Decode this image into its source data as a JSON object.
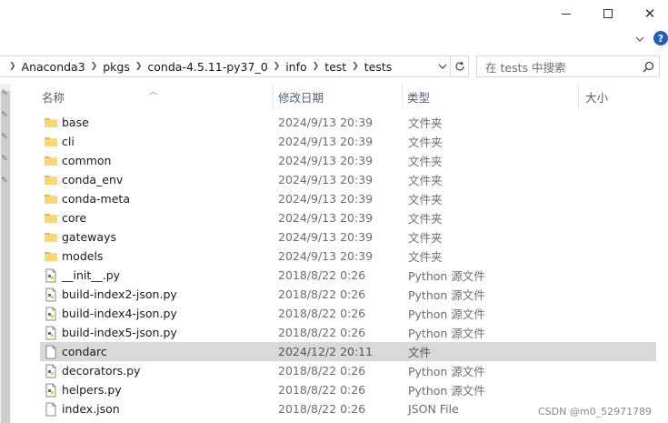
{
  "window": {
    "close_glyph": "✕"
  },
  "ribbon": {
    "help_label": "?"
  },
  "address_bar": {
    "crumbs": [
      "Anaconda3",
      "pkgs",
      "conda-4.5.11-py37_0",
      "info",
      "test",
      "tests"
    ]
  },
  "search": {
    "placeholder": "在 tests 中搜索"
  },
  "columns": {
    "name": "名称",
    "date": "修改日期",
    "type": "类型",
    "size": "大小"
  },
  "files": [
    {
      "name": "base",
      "date": "2024/9/13 20:39",
      "type": "文件夹",
      "icon": "folder-icon"
    },
    {
      "name": "cli",
      "date": "2024/9/13 20:39",
      "type": "文件夹",
      "icon": "folder-icon"
    },
    {
      "name": "common",
      "date": "2024/9/13 20:39",
      "type": "文件夹",
      "icon": "folder-icon"
    },
    {
      "name": "conda_env",
      "date": "2024/9/13 20:39",
      "type": "文件夹",
      "icon": "folder-icon"
    },
    {
      "name": "conda-meta",
      "date": "2024/9/13 20:39",
      "type": "文件夹",
      "icon": "folder-icon"
    },
    {
      "name": "core",
      "date": "2024/9/13 20:39",
      "type": "文件夹",
      "icon": "folder-icon"
    },
    {
      "name": "gateways",
      "date": "2024/9/13 20:39",
      "type": "文件夹",
      "icon": "folder-icon"
    },
    {
      "name": "models",
      "date": "2024/9/13 20:39",
      "type": "文件夹",
      "icon": "folder-icon"
    },
    {
      "name": "__init__.py",
      "date": "2018/8/22 0:26",
      "type": "Python 源文件",
      "icon": "python-file-icon"
    },
    {
      "name": "build-index2-json.py",
      "date": "2018/8/22 0:26",
      "type": "Python 源文件",
      "icon": "python-file-icon"
    },
    {
      "name": "build-index4-json.py",
      "date": "2018/8/22 0:26",
      "type": "Python 源文件",
      "icon": "python-file-icon"
    },
    {
      "name": "build-index5-json.py",
      "date": "2018/8/22 0:26",
      "type": "Python 源文件",
      "icon": "python-file-icon"
    },
    {
      "name": "condarc",
      "date": "2024/12/2 20:11",
      "type": "文件",
      "icon": "blank-file-icon",
      "selected": true
    },
    {
      "name": "decorators.py",
      "date": "2018/8/22 0:26",
      "type": "Python 源文件",
      "icon": "python-file-icon"
    },
    {
      "name": "helpers.py",
      "date": "2018/8/22 0:26",
      "type": "Python 源文件",
      "icon": "python-file-icon"
    },
    {
      "name": "index.json",
      "date": "2018/8/22 0:26",
      "type": "JSON File",
      "icon": "blank-file-icon"
    }
  ],
  "watermark": "CSDN @m0_52971789",
  "colors": {
    "folder": "#f8d775",
    "folder_dark": "#e6b84a",
    "selected_row": "#d9d9d9",
    "header_text": "#4c607a",
    "python_icon": "#3a78b8"
  }
}
